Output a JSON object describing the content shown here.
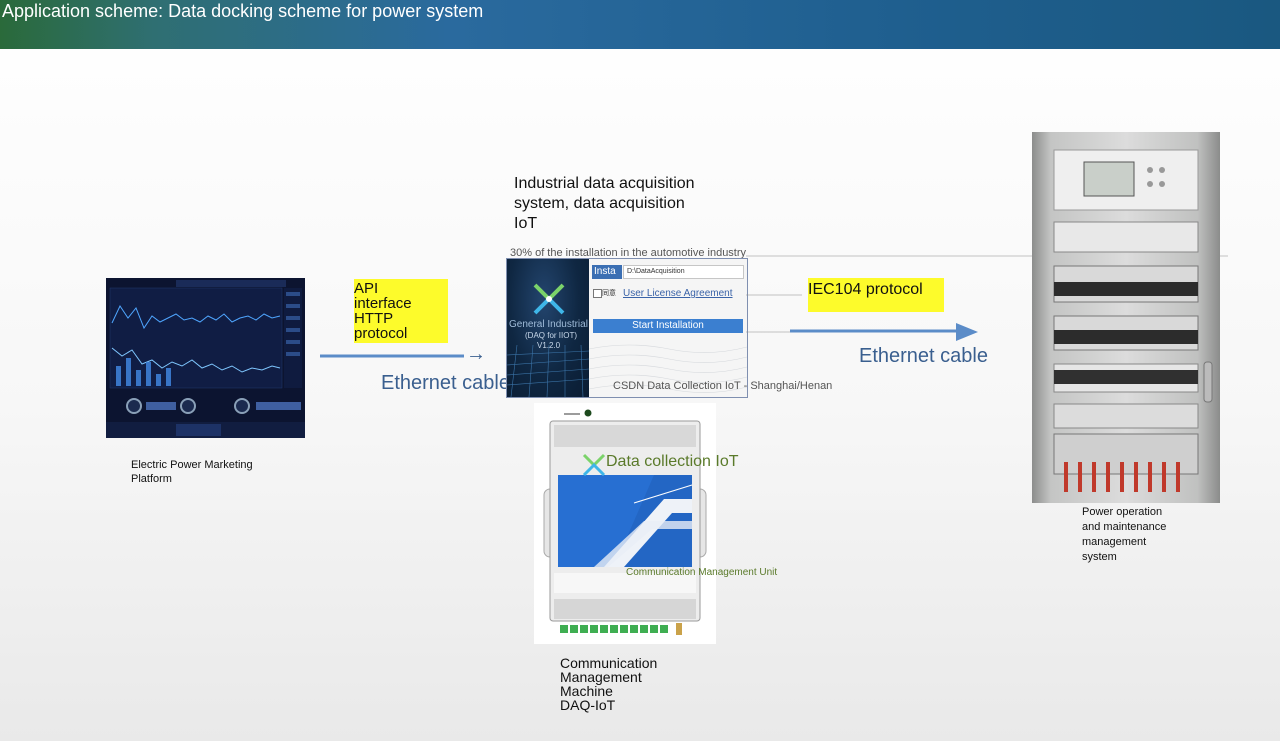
{
  "header": {
    "title": "Application scheme: Data docking scheme for power system"
  },
  "left_system": {
    "caption": [
      "Electric Power Marketing",
      "Platform"
    ]
  },
  "link_left": {
    "protocol_lines": [
      "API",
      "interface",
      "HTTP",
      "protocol"
    ],
    "cable_label": "Ethernet cable",
    "arrow_glyph": "→"
  },
  "center_system": {
    "title_lines": [
      "Industrial data acquisition",
      "system, data acquisition",
      "IoT"
    ],
    "overlay_text": "30% of the installation in the automotive industry",
    "installer": {
      "tab_label": "Insta",
      "path_value": "D:\\DataAcquisition",
      "checkbox_label": "同意",
      "license_link": "User License Agreement",
      "start_button": "Start Installation",
      "product_name": "General Industrial Data",
      "product_sub": "(DAQ for IIOT)",
      "version": "V1.2.0"
    },
    "csdn_text": "CSDN Data Collection IoT - Shanghai/Henan"
  },
  "link_right": {
    "protocol": "IEC104 protocol",
    "cable_label": "Ethernet cable"
  },
  "device": {
    "brand_text": "Data collection IoT",
    "subtitle": "Communication Management Unit",
    "caption": [
      "Communication",
      "Management",
      "Machine",
      "DAQ-IoT"
    ]
  },
  "right_system": {
    "caption": [
      "Power operation",
      "and maintenance",
      "management",
      "system"
    ]
  },
  "colors": {
    "highlight": "#fdfb2b",
    "arrow": "#5b8cc8",
    "cable_text": "#3a5f8f",
    "green_text": "#5a7a2a",
    "header_left": "#2a6a3a",
    "header_right": "#1a5880"
  }
}
